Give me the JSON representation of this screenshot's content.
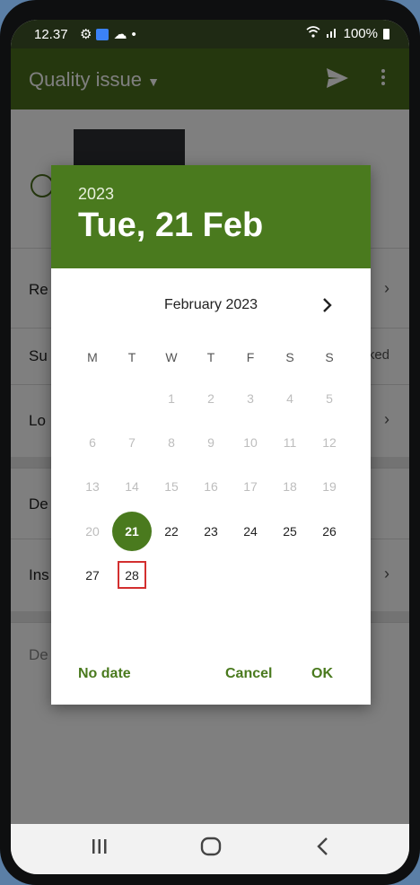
{
  "status_bar": {
    "time": "12.37",
    "battery": "100%"
  },
  "app_bar": {
    "title": "Quality issue"
  },
  "background_rows": [
    {
      "label": "Re"
    },
    {
      "label": "Su"
    },
    {
      "label": "Lo"
    },
    {
      "label": "De"
    },
    {
      "label": "Ins"
    },
    {
      "label": "De"
    }
  ],
  "background_right_text": "ked",
  "dialog": {
    "year": "2023",
    "selected_date_label": "Tue, 21 Feb",
    "month_label": "February 2023",
    "weekdays": [
      "M",
      "T",
      "W",
      "T",
      "F",
      "S",
      "S"
    ],
    "days": [
      {
        "n": "1",
        "state": "disabled"
      },
      {
        "n": "2",
        "state": "disabled"
      },
      {
        "n": "3",
        "state": "disabled"
      },
      {
        "n": "4",
        "state": "disabled"
      },
      {
        "n": "5",
        "state": "disabled"
      },
      {
        "n": "6",
        "state": "disabled"
      },
      {
        "n": "7",
        "state": "disabled"
      },
      {
        "n": "8",
        "state": "disabled"
      },
      {
        "n": "9",
        "state": "disabled"
      },
      {
        "n": "10",
        "state": "disabled"
      },
      {
        "n": "11",
        "state": "disabled"
      },
      {
        "n": "12",
        "state": "disabled"
      },
      {
        "n": "13",
        "state": "disabled"
      },
      {
        "n": "14",
        "state": "disabled"
      },
      {
        "n": "15",
        "state": "disabled"
      },
      {
        "n": "16",
        "state": "disabled"
      },
      {
        "n": "17",
        "state": "disabled"
      },
      {
        "n": "18",
        "state": "disabled"
      },
      {
        "n": "19",
        "state": "disabled"
      },
      {
        "n": "20",
        "state": "disabled"
      },
      {
        "n": "21",
        "state": "selected"
      },
      {
        "n": "22",
        "state": "enabled"
      },
      {
        "n": "23",
        "state": "enabled"
      },
      {
        "n": "24",
        "state": "enabled"
      },
      {
        "n": "25",
        "state": "enabled"
      },
      {
        "n": "26",
        "state": "enabled"
      },
      {
        "n": "27",
        "state": "enabled"
      },
      {
        "n": "28",
        "state": "highlighted"
      }
    ],
    "buttons": {
      "no_date": "No date",
      "cancel": "Cancel",
      "ok": "OK"
    }
  },
  "colors": {
    "accent": "#4a7a1e",
    "highlight_border": "#d32f2f"
  }
}
